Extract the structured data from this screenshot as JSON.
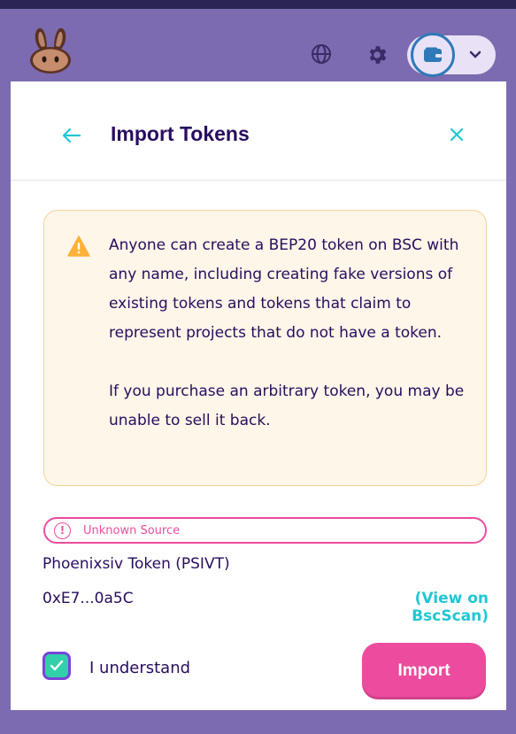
{
  "header": {
    "logo_icon": "bunny-logo-icon",
    "globe_icon": "globe-icon",
    "settings_icon": "gear-icon",
    "wallet_icon": "wallet-icon",
    "menu_icon": "chevron-down-icon"
  },
  "modal": {
    "title": "Import Tokens",
    "back_icon": "arrow-left-icon",
    "close_icon": "close-icon"
  },
  "warning": {
    "icon": "warning-triangle-icon",
    "paragraph_1": "Anyone can create a BEP20 token on BSC with any name, including creating fake versions of existing tokens and tokens that claim to represent projects that do not have a token.",
    "paragraph_2": "If you purchase an arbitrary token, you may be unable to sell it back."
  },
  "badge": {
    "icon_glyph": "!",
    "label": "Unknown Source"
  },
  "token": {
    "name": "Phoenixsiv Token  (PSIVT)",
    "address": "0xE7...0a5C",
    "explorer_link": "(View on BscScan)"
  },
  "acknowledge": {
    "label": "I understand",
    "checked": true
  },
  "import_button": {
    "label": "Import"
  },
  "colors": {
    "primary_text": "#280d5f",
    "accent_cyan": "#1fc7d4",
    "pink": "#ed4b9e",
    "warning_bg": "#fef6e9",
    "overlay": "#7c6bb0",
    "checkbox_green": "#31d0aa"
  }
}
